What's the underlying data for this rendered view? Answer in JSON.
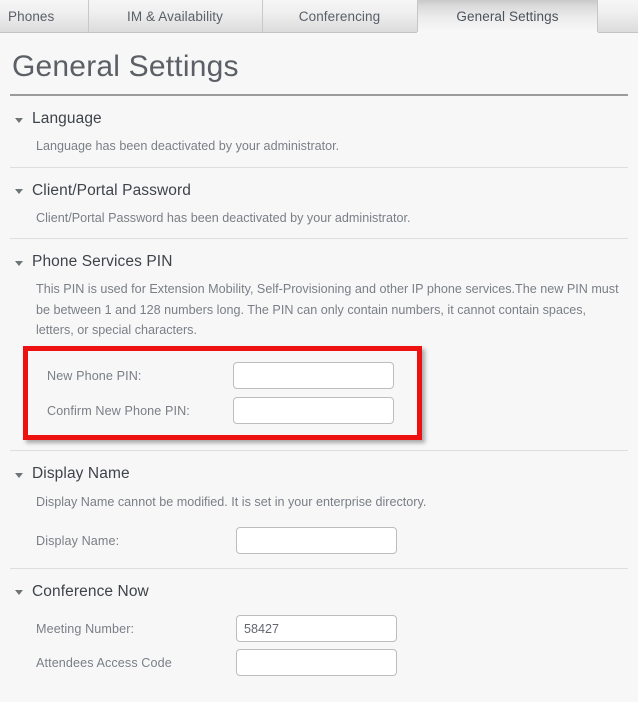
{
  "tabs": [
    {
      "label": "Phones",
      "active": false
    },
    {
      "label": "IM & Availability",
      "active": false
    },
    {
      "label": "Conferencing",
      "active": false
    },
    {
      "label": "General Settings",
      "active": true
    }
  ],
  "page": {
    "title": "General Settings"
  },
  "sections": [
    {
      "id": "language",
      "title": "Language",
      "caret": "caret-down-icon",
      "description": "Language has been deactivated by your administrator.",
      "fields": []
    },
    {
      "id": "client-portal-password",
      "title": "Client/Portal Password",
      "caret": "caret-down-icon",
      "description": "Client/Portal Password has been deactivated by your administrator.",
      "fields": []
    },
    {
      "id": "phone-services-pin",
      "title": "Phone Services PIN",
      "caret": "caret-down-icon",
      "description": "This PIN is used for Extension Mobility, Self-Provisioning and other IP phone services.The new PIN must be between 1 and 128 numbers long. The PIN can only contain numbers, it cannot contain spaces, letters, or special characters.",
      "highlighted": true,
      "highlight_color": "#ee1111",
      "fields": [
        {
          "id": "new-phone-pin",
          "label": "New Phone PIN:",
          "value": "",
          "placeholder": ""
        },
        {
          "id": "confirm-new-phone-pin",
          "label": "Confirm New Phone PIN:",
          "value": "",
          "placeholder": ""
        }
      ]
    },
    {
      "id": "display-name",
      "title": "Display Name",
      "caret": "caret-down-icon",
      "description": "Display Name cannot be modified. It is set in your enterprise directory.",
      "fields": [
        {
          "id": "display-name-field",
          "label": "Display Name:",
          "value": "",
          "placeholder": ""
        }
      ]
    },
    {
      "id": "conference-now",
      "title": "Conference Now",
      "caret": "caret-down-icon",
      "description": "",
      "fields": [
        {
          "id": "meeting-number",
          "label": "Meeting Number:",
          "value": "58427",
          "placeholder": ""
        },
        {
          "id": "attendees-access-code",
          "label": "Attendees Access Code",
          "value": "",
          "placeholder": ""
        }
      ]
    }
  ]
}
